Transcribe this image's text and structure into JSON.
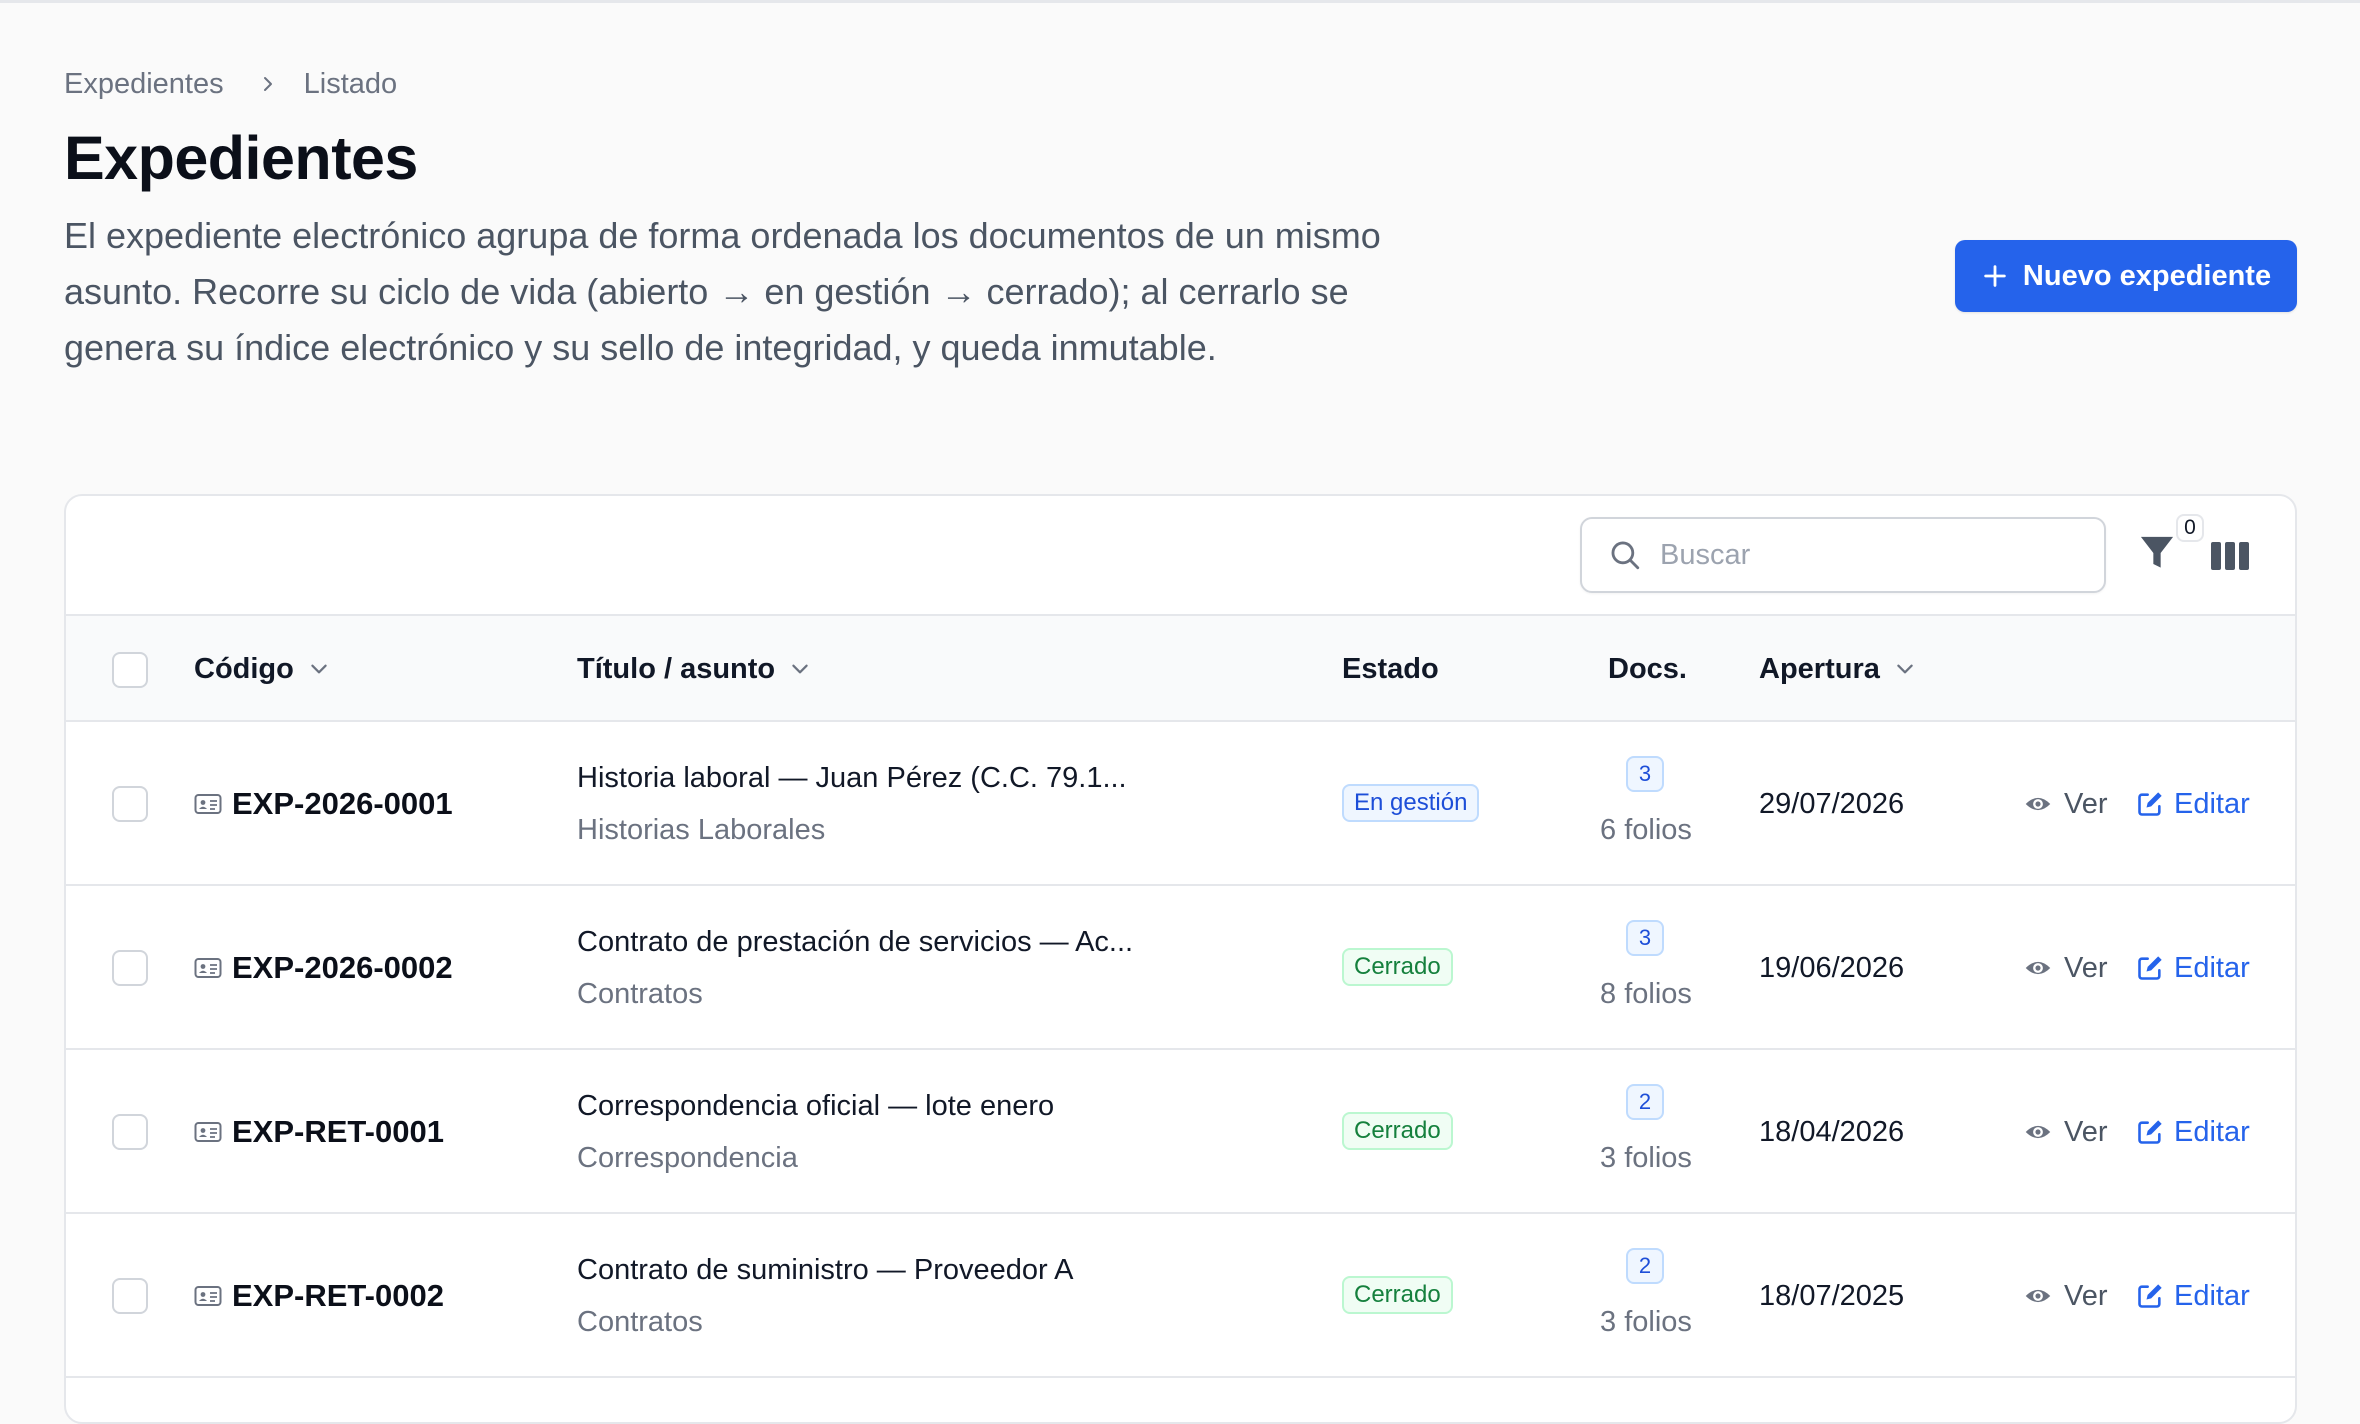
{
  "breadcrumb": {
    "parent": "Expedientes",
    "current": "Listado"
  },
  "page": {
    "title": "Expedientes",
    "description": "El expediente electrónico agrupa de forma ordenada los documentos de un mismo asunto. Recorre su ciclo de vida (abierto → en gestión → cerrado); al cerrarlo se genera su índice electrónico y su sello de integridad, y queda inmutable."
  },
  "actions": {
    "new_label": "Nuevo expediente"
  },
  "toolbar": {
    "search_placeholder": "Buscar",
    "filter_count": "0"
  },
  "table": {
    "headers": {
      "code": "Código",
      "title": "Título / asunto",
      "status": "Estado",
      "docs": "Docs.",
      "opened": "Apertura"
    },
    "view_label": "Ver",
    "edit_label": "Editar",
    "rows": [
      {
        "code": "EXP-2026-0001",
        "title": "Historia laboral — Juan Pérez (C.C. 79.1...",
        "series": "Historias Laborales",
        "status": "En gestión",
        "status_kind": "gestion",
        "docs": "3",
        "folios": "6 folios",
        "opened": "29/07/2026"
      },
      {
        "code": "EXP-2026-0002",
        "title": "Contrato de prestación de servicios — Ac...",
        "series": "Contratos",
        "status": "Cerrado",
        "status_kind": "cerrado",
        "docs": "3",
        "folios": "8 folios",
        "opened": "19/06/2026"
      },
      {
        "code": "EXP-RET-0001",
        "title": "Correspondencia oficial — lote enero",
        "series": "Correspondencia",
        "status": "Cerrado",
        "status_kind": "cerrado",
        "docs": "2",
        "folios": "3 folios",
        "opened": "18/04/2026"
      },
      {
        "code": "EXP-RET-0002",
        "title": "Contrato de suministro — Proveedor A",
        "series": "Contratos",
        "status": "Cerrado",
        "status_kind": "cerrado",
        "docs": "2",
        "folios": "3 folios",
        "opened": "18/07/2025"
      }
    ]
  },
  "colors": {
    "primary": "#2563eb",
    "status_gestion": "#1d4ed8",
    "status_cerrado": "#15803d",
    "border": "#e5e7eb"
  },
  "icons": {
    "breadcrumb_separator": "chevron-right-icon",
    "new": "plus-icon",
    "search": "search-icon",
    "filter": "funnel-icon",
    "columns": "columns-icon",
    "sort": "chevron-down-icon",
    "code": "id-card-icon",
    "view": "eye-icon",
    "edit": "pencil-square-icon"
  }
}
